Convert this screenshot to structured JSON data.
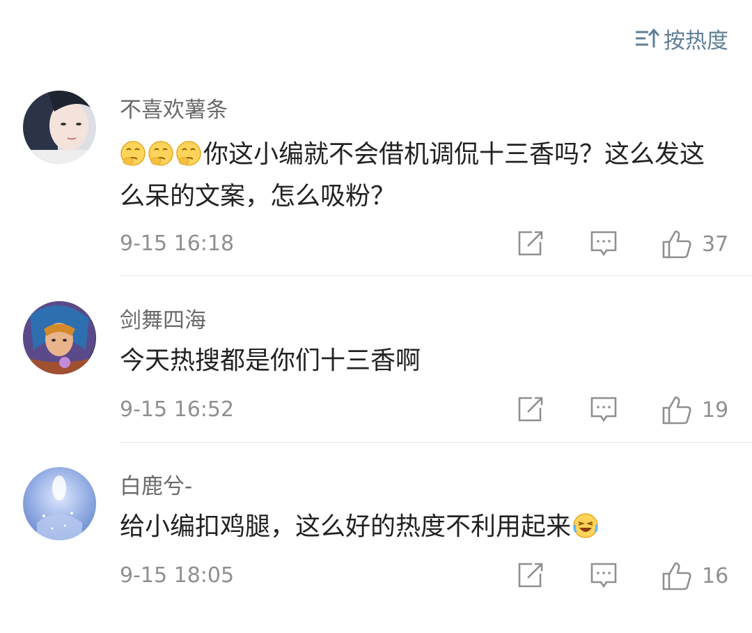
{
  "sort": {
    "label": "按热度",
    "icon": "sort-icon",
    "color": "#5f7f96"
  },
  "comments": [
    {
      "username": "不喜欢薯条",
      "emojis": [
        "thinking-emoji",
        "thinking-emoji",
        "thinking-emoji"
      ],
      "text": "你这小编就不会借机调侃十三香吗？这么发这么呆的文案，怎么吸粉？",
      "time": "9-15 16:18",
      "likes": "37"
    },
    {
      "username": "剑舞四海",
      "emojis": [],
      "text": "今天热搜都是你们十三香啊",
      "time": "9-15 16:52",
      "likes": "19"
    },
    {
      "username": "白鹿兮-",
      "emojis": [],
      "text": "给小编扣鸡腿，这么好的热度不利用起来",
      "trailing_emoji": "laugh-cry-emoji",
      "time": "9-15 18:05",
      "likes": "16"
    }
  ],
  "colors": {
    "username": "#6a6a6a",
    "text": "#222222",
    "meta": "#8f8f8f",
    "divider": "#e6e6e6"
  }
}
